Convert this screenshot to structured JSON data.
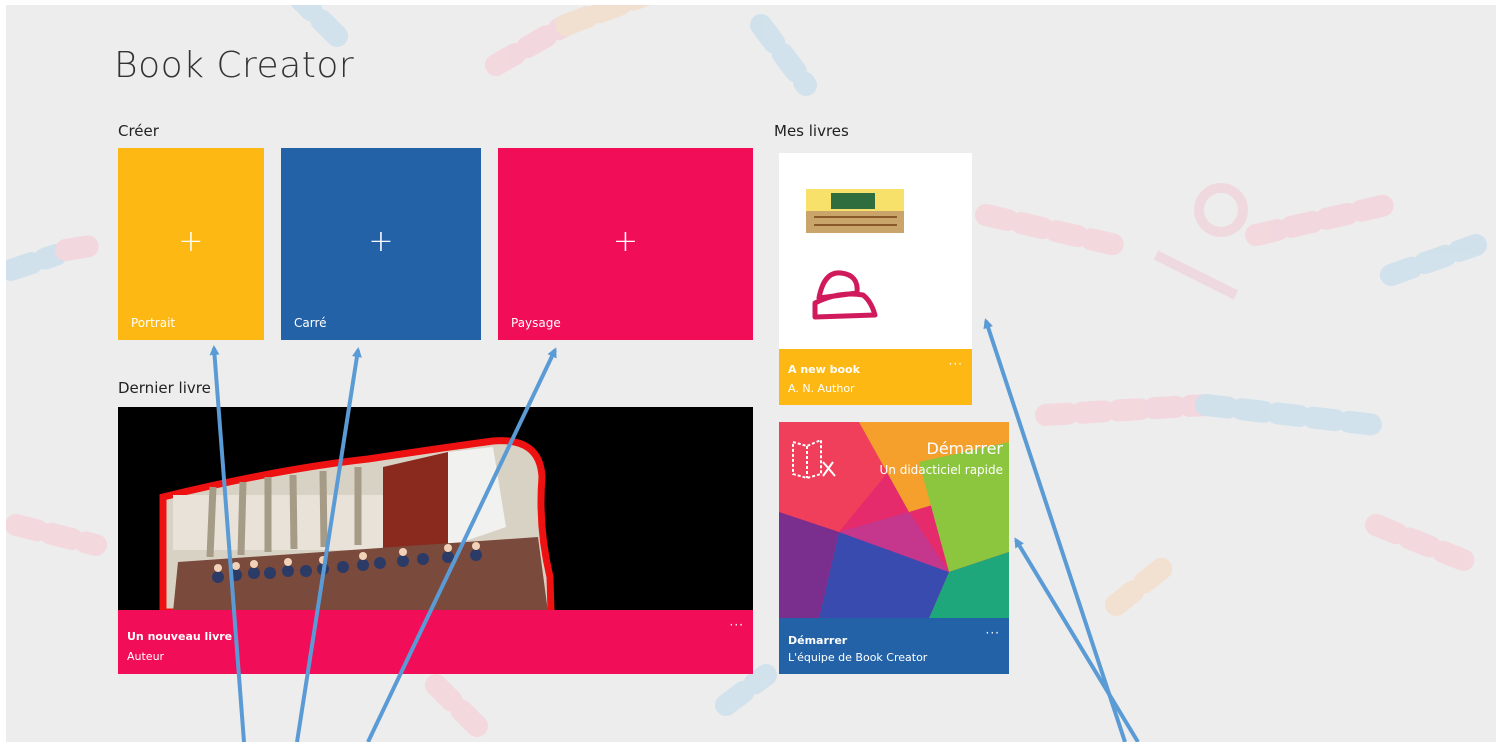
{
  "app": {
    "title": "Book Creator"
  },
  "create": {
    "heading": "Créer",
    "tiles": [
      {
        "label": "Portrait",
        "icon": "plus-icon",
        "color": "#fdb813"
      },
      {
        "label": "Carré",
        "icon": "plus-icon",
        "color": "#2462a8"
      },
      {
        "label": "Paysage",
        "icon": "plus-icon",
        "color": "#f20d58"
      }
    ]
  },
  "latest": {
    "heading": "Dernier livre",
    "book": {
      "title": "Un nouveau livre",
      "author": "Auteur",
      "more": "···",
      "color": "#f20d58"
    }
  },
  "my_books": {
    "heading": "Mes livres",
    "books": [
      {
        "title": "A new book",
        "author": "A. N. Author",
        "more": "···",
        "color": "#fdb813"
      },
      {
        "title": "Démarrer",
        "author": "L'équipe de Book Creator",
        "more": "···",
        "color": "#2462a8",
        "cover_heading": "Démarrer",
        "cover_subtitle": "Un didacticiel rapide"
      }
    ]
  },
  "colors": {
    "background": "#ededed",
    "annotation_arrow": "#5b9bd5"
  }
}
